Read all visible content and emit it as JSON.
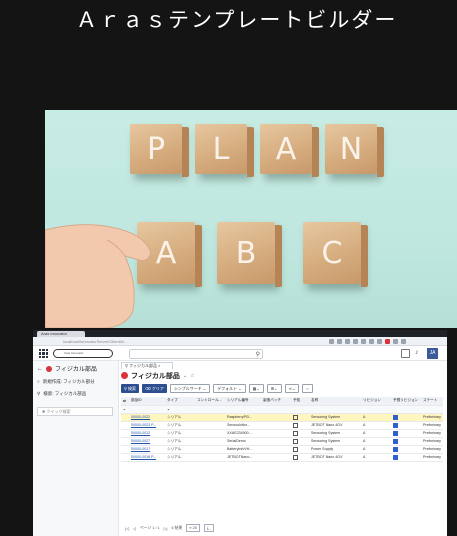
{
  "slide": {
    "title": "Ａｒａｓテンプレートビルダー"
  },
  "photo": {
    "blocks_top": [
      "P",
      "L",
      "A",
      "N"
    ],
    "blocks_bottom": [
      "A",
      "B",
      "C"
    ]
  },
  "screenshot": {
    "browser_tab": "Aras Innovator",
    "address": "localhost/InnovatorServer/Client/#/...",
    "app": {
      "logo_text": "Aras Innovator",
      "avatar": "JA"
    },
    "sidebar": {
      "heading": "フィジカル部品",
      "items": [
        {
          "icon": "new-icon",
          "label": "新規作成: フィジカル部分"
        },
        {
          "icon": "search-icon",
          "label": "検索: フィジカル部品"
        }
      ],
      "filter_placeholder": "クイック検索"
    },
    "main": {
      "doc_tab": "フィジカル部品",
      "title": "フィジカル部品",
      "toolbar": {
        "search": "検索",
        "clear": "クリア",
        "search_mode": "シンプルサーチ",
        "view": "デフォルト"
      },
      "columns": [
        "部品ID",
        "タイプ",
        "コントロール...",
        "シリアル番号",
        "製造バッチ",
        "予知",
        "名称",
        "リビジョン",
        "予想リビジョン",
        "ステート"
      ],
      "rows": [
        {
          "id": "00000-0022",
          "type": "シリアル",
          "serial": "RaspberryPi3...",
          "checked": false,
          "name": "Sensoring System",
          "rev": "A",
          "flag": true,
          "state": "Preliminary",
          "selected": true
        },
        {
          "id": "00000-0023 P...",
          "type": "シリアル",
          "serial": "Sensoukitfor...",
          "checked": false,
          "name": "JETBOT Nano 4GV",
          "rev": "A",
          "flag": true,
          "state": "Preliminary",
          "selected": false
        },
        {
          "id": "00000-0012",
          "type": "シリアル",
          "serial": "XXAE234900...",
          "checked": false,
          "name": "Sensoring System",
          "rev": "A",
          "flag": true,
          "state": "Preliminary",
          "selected": false
        },
        {
          "id": "00000-0027",
          "type": "シリアル",
          "serial": "SerialDemo",
          "checked": false,
          "name": "Sensoring System",
          "rev": "A",
          "flag": true,
          "state": "Preliminary",
          "selected": false
        },
        {
          "id": "00000-0017",
          "type": "シリアル",
          "serial": "BatteryInfoVH...",
          "checked": false,
          "name": "Power Supply",
          "rev": "A",
          "flag": true,
          "state": "Preliminary",
          "selected": false
        },
        {
          "id": "00000-0018 P...",
          "type": "シリアル",
          "serial": "JETBOTNano...",
          "checked": false,
          "name": "JETBOT Nano 4GV",
          "rev": "A",
          "flag": true,
          "state": "Preliminary",
          "selected": false
        }
      ],
      "pager": {
        "page": "ページ 1 / 1",
        "count": "6 結果",
        "page_size": "25"
      }
    }
  }
}
